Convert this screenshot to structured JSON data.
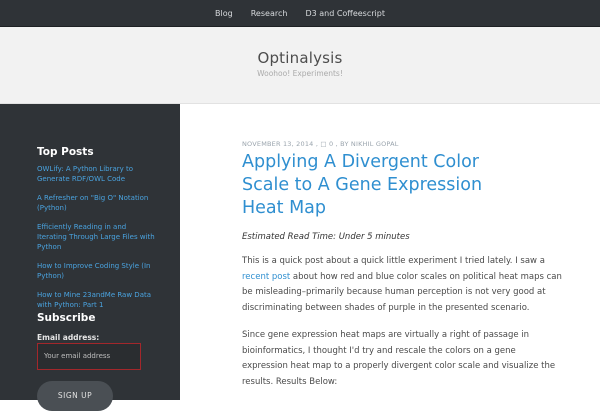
{
  "nav": {
    "items": [
      "Blog",
      "Research",
      "D3 and Coffeescript"
    ]
  },
  "header": {
    "title": "Optinalysis",
    "tagline": "Woohoo! Experiments!"
  },
  "sidebar": {
    "top_posts_heading": "Top Posts",
    "posts": [
      "OWLify: A Python Library to Generate RDF/OWL Code",
      "A Refresher on \"Big O\" Notation (Python)",
      "Efficiently Reading in and Iterating Through Large Files with Python",
      "How to Improve Coding Style (In Python)",
      "How to Mine 23andMe Raw Data with Python: Part 1"
    ],
    "subscribe_heading": "Subscribe",
    "email_label": "Email address:",
    "email_placeholder": "Your email address",
    "signup_label": "SIGN UP"
  },
  "post": {
    "date": "NOVEMBER 13, 2014",
    "comments": "0",
    "author": "BY NIKHIL GOPAL",
    "title": "Applying A Divergent Color Scale to A Gene Expression Heat Map",
    "read_time": "Estimated Read Time: Under 5 minutes",
    "p1_before": "This is a quick post about a quick little experiment I tried lately. I saw a ",
    "p1_link": "recent post",
    "p1_after": " about how red and blue color scales on political heat maps can be misleading–primarily because human perception is not very good at discriminating between shades of purple in the presented scenario.",
    "p2": "Since gene expression heat maps are virtually a right of passage in bioinformatics, I thought I'd try and rescale the colors on a gene expression heat map to a properly divergent color scale and visualize the results. Results Below:"
  }
}
